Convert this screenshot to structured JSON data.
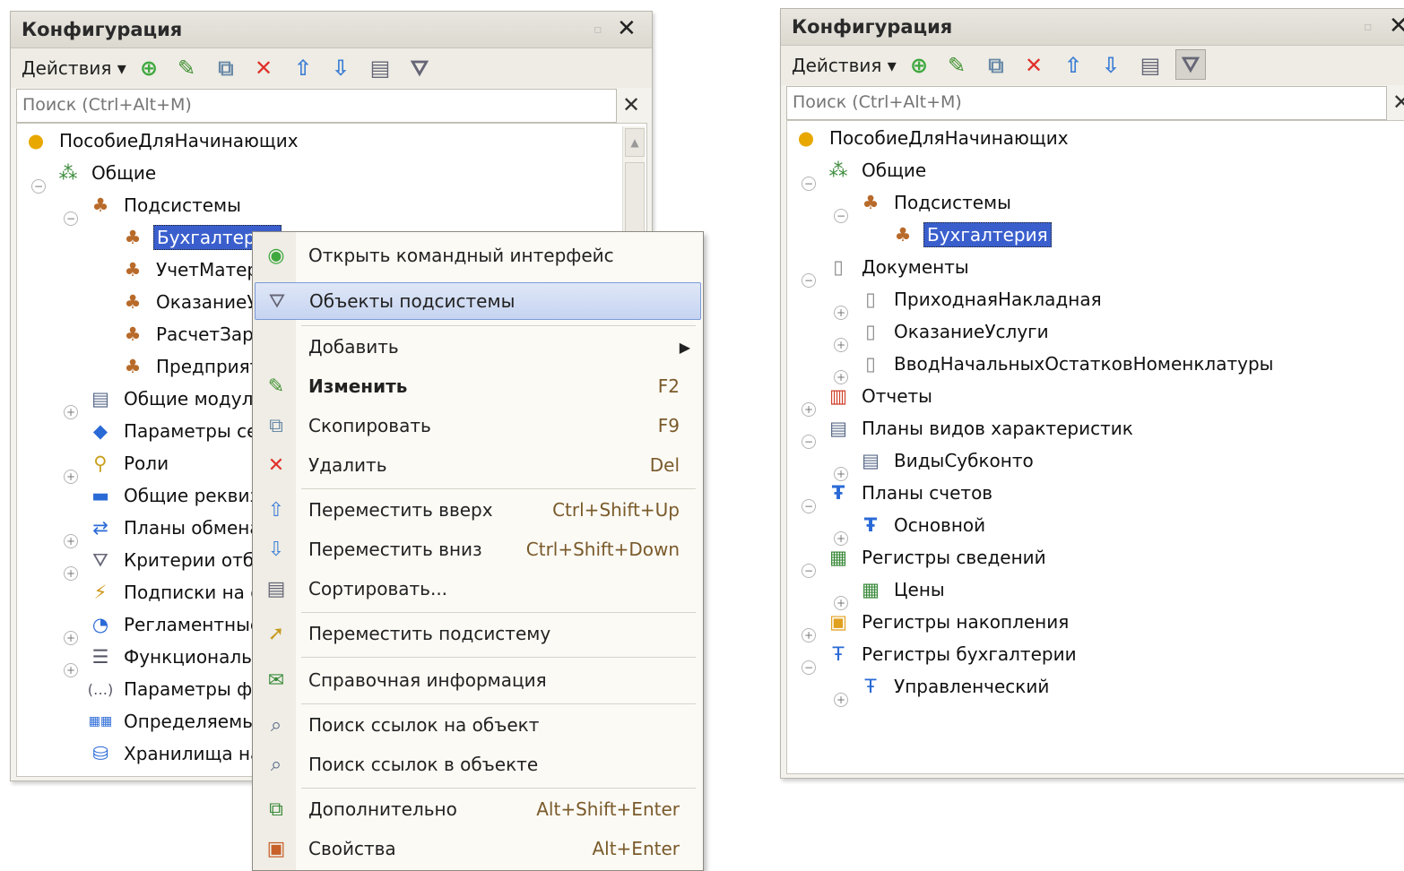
{
  "left_panel": {
    "title": "Конфигурация",
    "actions_label": "Действия ▾",
    "search_placeholder": "Поиск (Ctrl+Alt+M)",
    "tree": [
      {
        "label": "ПособиеДляНачинающих",
        "icon": "config-icon"
      },
      {
        "label": "Общие",
        "icon": "common-icon"
      },
      {
        "label": "Подсистемы",
        "icon": "subsystem-icon"
      },
      {
        "label": "Бухгалтерия",
        "icon": "subsystem-icon"
      },
      {
        "label": "УчетМатер",
        "icon": "subsystem-icon"
      },
      {
        "label": "ОказаниеУ",
        "icon": "subsystem-icon"
      },
      {
        "label": "РасчетЗар",
        "icon": "subsystem-icon"
      },
      {
        "label": "Предприят",
        "icon": "subsystem-icon"
      },
      {
        "label": "Общие модули",
        "icon": "module-icon"
      },
      {
        "label": "Параметры се",
        "icon": "session-params-icon"
      },
      {
        "label": "Роли",
        "icon": "role-icon"
      },
      {
        "label": "Общие реквиз",
        "icon": "common-attr-icon"
      },
      {
        "label": "Планы обмена",
        "icon": "exchange-plan-icon"
      },
      {
        "label": "Критерии отбо",
        "icon": "filter-criteria-icon"
      },
      {
        "label": "Подписки на с",
        "icon": "subscription-icon"
      },
      {
        "label": "Регламентные",
        "icon": "scheduled-job-icon"
      },
      {
        "label": "Функциональн",
        "icon": "functional-option-icon"
      },
      {
        "label": "Параметры фу",
        "icon": "fo-params-icon"
      },
      {
        "label": "Определяемы",
        "icon": "defined-type-icon"
      },
      {
        "label": "Хранилища на",
        "icon": "storage-icon"
      }
    ]
  },
  "context_menu": [
    {
      "label": "Открыть командный интерфейс",
      "shortcut": "",
      "icon": "command-interface-icon"
    },
    {
      "label": "Объекты подсистемы",
      "shortcut": "",
      "icon": "subsystem-objects-icon"
    },
    {
      "label": "Добавить",
      "shortcut": "",
      "icon": ""
    },
    {
      "label": "Изменить",
      "shortcut": "F2",
      "icon": "pencil-icon"
    },
    {
      "label": "Скопировать",
      "shortcut": "F9",
      "icon": "copy-icon"
    },
    {
      "label": "Удалить",
      "shortcut": "Del",
      "icon": "delete-icon"
    },
    {
      "label": "Переместить вверх",
      "shortcut": "Ctrl+Shift+Up",
      "icon": "move-up-icon"
    },
    {
      "label": "Переместить вниз",
      "shortcut": "Ctrl+Shift+Down",
      "icon": "move-down-icon"
    },
    {
      "label": "Сортировать...",
      "shortcut": "",
      "icon": "sort-icon"
    },
    {
      "label": "Переместить подсистему",
      "shortcut": "",
      "icon": "move-subsystem-icon"
    },
    {
      "label": "Справочная информация",
      "shortcut": "",
      "icon": "help-info-icon"
    },
    {
      "label": "Поиск ссылок на объект",
      "shortcut": "",
      "icon": "find-refs-to-icon"
    },
    {
      "label": "Поиск ссылок в объекте",
      "shortcut": "",
      "icon": "find-refs-in-icon"
    },
    {
      "label": "Дополнительно",
      "shortcut": "Alt+Shift+Enter",
      "icon": "additional-icon"
    },
    {
      "label": "Свойства",
      "shortcut": "Alt+Enter",
      "icon": "properties-icon"
    }
  ],
  "right_panel": {
    "title": "Конфигурация",
    "actions_label": "Действия ▾",
    "search_placeholder": "Поиск (Ctrl+Alt+M)",
    "tree": [
      {
        "label": "ПособиеДляНачинающих",
        "icon": "config-icon"
      },
      {
        "label": "Общие",
        "icon": "common-icon"
      },
      {
        "label": "Подсистемы",
        "icon": "subsystem-icon"
      },
      {
        "label": "Бухгалтерия",
        "icon": "subsystem-icon"
      },
      {
        "label": "Документы",
        "icon": "documents-icon"
      },
      {
        "label": "ПриходнаяНакладная",
        "icon": "document-icon"
      },
      {
        "label": "ОказаниеУслуги",
        "icon": "document-icon"
      },
      {
        "label": "ВводНачальныхОстатковНоменклатуры",
        "icon": "document-icon"
      },
      {
        "label": "Отчеты",
        "icon": "reports-icon"
      },
      {
        "label": "Планы видов характеристик",
        "icon": "characteristics-plan-icon"
      },
      {
        "label": "ВидыСубконто",
        "icon": "characteristics-plan-icon"
      },
      {
        "label": "Планы счетов",
        "icon": "chart-of-accounts-icon"
      },
      {
        "label": "Основной",
        "icon": "chart-of-accounts-icon"
      },
      {
        "label": "Регистры сведений",
        "icon": "info-register-icon"
      },
      {
        "label": "Цены",
        "icon": "info-register-icon"
      },
      {
        "label": "Регистры накопления",
        "icon": "accumulation-register-icon"
      },
      {
        "label": "Регистры бухгалтерии",
        "icon": "accounting-register-icon"
      },
      {
        "label": "Управленческий",
        "icon": "accounting-register-icon"
      }
    ]
  },
  "colors": {
    "selection": "#3a5fcd",
    "menu_hover": "#c6d4f1"
  }
}
